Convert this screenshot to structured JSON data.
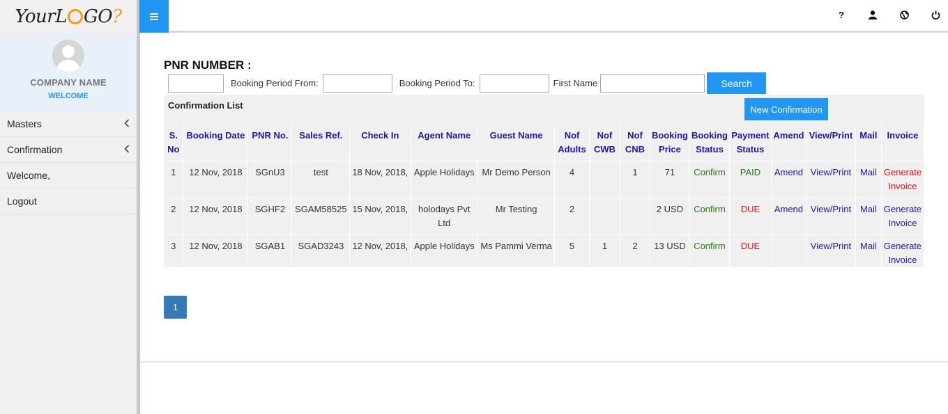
{
  "brand": {
    "logo_pre": "Your",
    "logo_l": "L",
    "logo_o": "",
    "logo_go": "GO",
    "logo_q": "?"
  },
  "profile": {
    "company": "COMPANY NAME",
    "welcome": "WELCOME"
  },
  "sidebar": {
    "items": [
      {
        "label": "Masters",
        "has_chevron": true
      },
      {
        "label": "Confirmation",
        "has_chevron": true
      },
      {
        "label": "Welcome,",
        "has_chevron": false
      },
      {
        "label": "Logout",
        "has_chevron": false
      }
    ]
  },
  "topbar": {
    "menu_icon": "≡",
    "icons": [
      "help-icon",
      "user-icon",
      "globe-icon",
      "power-icon"
    ],
    "help_glyph": "?"
  },
  "search": {
    "pnr_label": "PNR NUMBER :",
    "pnr_value": "",
    "from_label": "Booking Period From:",
    "from_value": "",
    "to_label": "Booking Period To:",
    "to_value": "",
    "first_name_label": "First Name",
    "first_name_value": "",
    "search_button": "Search"
  },
  "list": {
    "title": "Confirmation List",
    "new_button": "New Confirmation",
    "columns": [
      "S. No",
      "Booking Date",
      "PNR No.",
      "Sales Ref.",
      "Check In",
      "Agent Name",
      "Guest Name",
      "Nof Adults",
      "Nof CWB",
      "Nof CNB",
      "Booking Price",
      "Booking Status",
      "Payment Status",
      "Amend",
      "View/Print",
      "Mail",
      "Invoice"
    ],
    "rows": [
      {
        "sno": "1",
        "booking_date": "12 Nov, 2018",
        "pnr": "SGnU3",
        "sales_ref": "test",
        "check_in": "18 Nov, 2018,",
        "agent": "Apple Holidays",
        "guest": "Mr Demo Person",
        "adults": "4",
        "cwb": "",
        "cnb": "1",
        "price": "71",
        "status": "Confirm",
        "payment": "PAID",
        "amend": "Amend",
        "view": "View/Print",
        "mail": "Mail",
        "invoice": "Generate Invoice",
        "invoice_color": "red",
        "payment_color": "green"
      },
      {
        "sno": "2",
        "booking_date": "12 Nov, 2018",
        "pnr": "SGHF2",
        "sales_ref": "SGAM58525",
        "check_in": "15 Nov, 2018,",
        "agent": "holodays Pvt Ltd",
        "guest": "Mr Testing",
        "adults": "2",
        "cwb": "",
        "cnb": "",
        "price": "2 USD",
        "status": "Confirm",
        "payment": "DUE",
        "amend": "Amend",
        "view": "View/Print",
        "mail": "Mail",
        "invoice": "Generate Invoice",
        "invoice_color": "blue",
        "payment_color": "red"
      },
      {
        "sno": "3",
        "booking_date": "12 Nov, 2018",
        "pnr": "SGAB1",
        "sales_ref": "SGAD3243",
        "check_in": "12 Nov, 2018,",
        "agent": "Apple Holidays",
        "guest": "Ms Pammi Verma",
        "adults": "5",
        "cwb": "1",
        "cnb": "2",
        "price": "13 USD",
        "status": "Confirm",
        "payment": "DUE",
        "amend": "",
        "view": "View/Print",
        "mail": "Mail",
        "invoice": "Generate Invoice",
        "invoice_color": "blue",
        "payment_color": "red"
      }
    ]
  },
  "pagination": {
    "current": "1"
  },
  "colors": {
    "accent": "#2196f3",
    "page": "#337ab7",
    "header_text": "#1a1aa6",
    "confirm": "#2a7a1a",
    "due": "#d9140e"
  }
}
